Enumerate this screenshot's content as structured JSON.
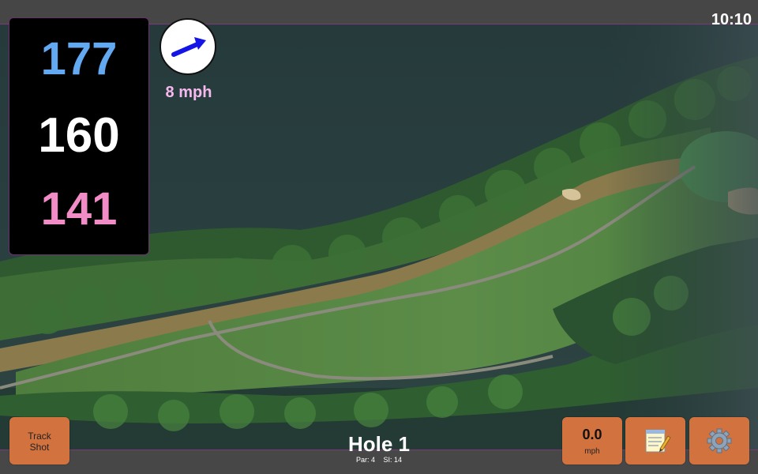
{
  "status_bar": {
    "time": "10:10"
  },
  "distances": {
    "back": "177",
    "middle": "160",
    "front": "141"
  },
  "wind": {
    "speed": "8 mph",
    "arrow_color": "#1414e6"
  },
  "hole": {
    "title": "Hole 1",
    "par": "Par: 4",
    "stroke_index": "SI: 14"
  },
  "controls": {
    "track_shot": {
      "line1": "Track",
      "line2": "Shot"
    },
    "speed": {
      "value": "0.0",
      "unit": "mph"
    },
    "notes_icon": "notepad-icon",
    "settings_icon": "gear-icon"
  },
  "colors": {
    "button_bg": "#d2733f",
    "back_distance": "#62a9f2",
    "middle_distance": "#ffffff",
    "front_distance": "#f28cc6",
    "wind_text": "#f6b8ee"
  }
}
